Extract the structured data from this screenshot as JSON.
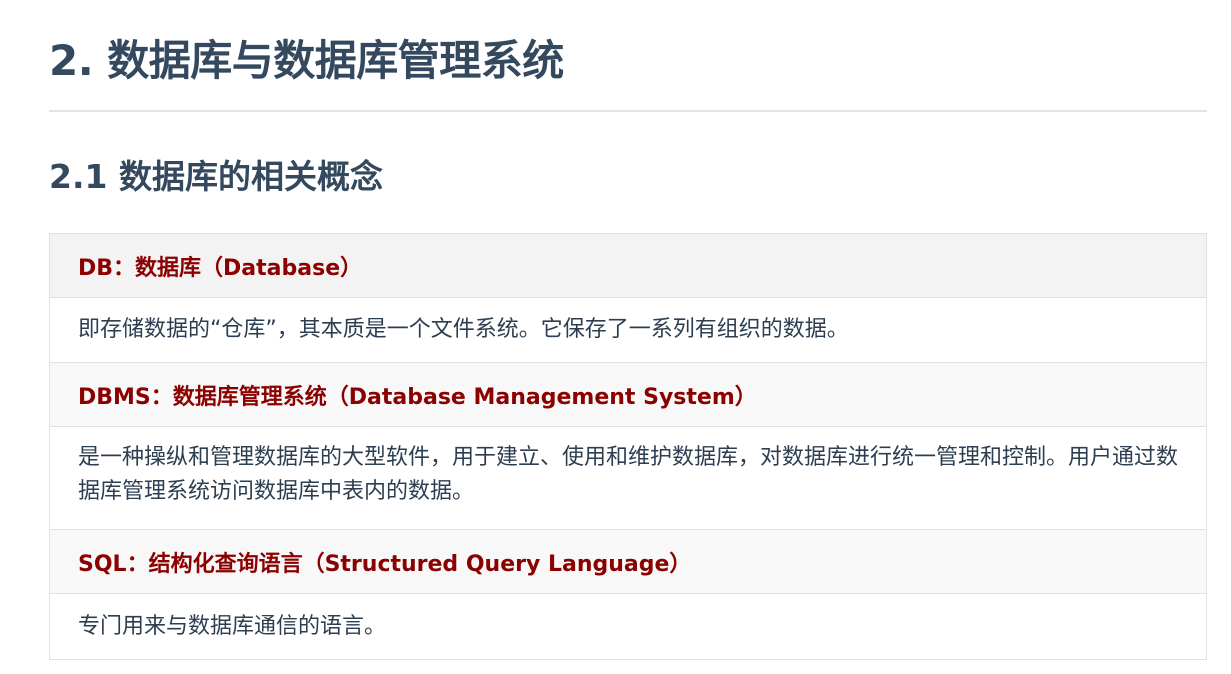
{
  "heading_main": "2. 数据库与数据库管理系统",
  "heading_sub": "2.1 数据库的相关概念",
  "definitions": [
    {
      "term": "DB：数据库（Database）",
      "description": "即存储数据的“仓库”，其本质是一个文件系统。它保存了一系列有组织的数据。"
    },
    {
      "term": "DBMS：数据库管理系统（Database Management System）",
      "description": "是一种操纵和管理数据库的大型软件，用于建立、使用和维护数据库，对数据库进行统一管理和控制。用户通过数据库管理系统访问数据库中表内的数据。"
    },
    {
      "term": "SQL：结构化查询语言（Structured Query Language）",
      "description": "专门用来与数据库通信的语言。"
    }
  ]
}
